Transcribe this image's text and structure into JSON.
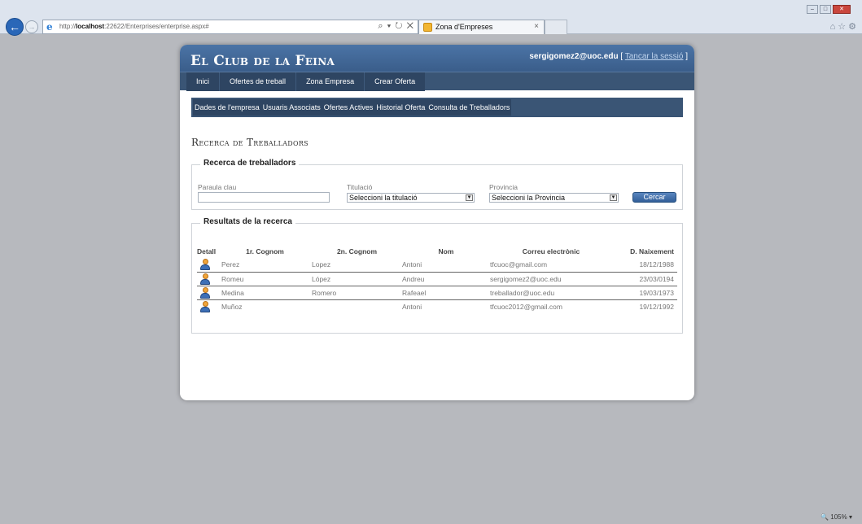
{
  "browser": {
    "url_prefix": "http://",
    "url_host": "localhost",
    "url_rest": ":22622/Enterprises/enterprise.aspx#",
    "address_tools": "⌕ ▾ ↻ ✕",
    "tab_title": "Zona d'Empreses",
    "tab_close": "×",
    "zoom": "105%"
  },
  "site": {
    "logo": "El Club de la Feina",
    "user_email": "sergigomez2@uoc.edu",
    "bracket_open": "[",
    "logout": "Tancar la sessió",
    "bracket_close": "]"
  },
  "menu": {
    "items": [
      {
        "label": "Inici"
      },
      {
        "label": "Ofertes de treball"
      },
      {
        "label": "Zona Empresa"
      },
      {
        "label": "Crear Oferta"
      }
    ]
  },
  "submenu": {
    "items": [
      {
        "label": "Dades de l'empresa"
      },
      {
        "label": "Usuaris Associats"
      },
      {
        "label": "Ofertes Actives"
      },
      {
        "label": "Historial Oferta"
      },
      {
        "label": "Consulta de Treballadors"
      }
    ]
  },
  "page": {
    "title": "Recerca de Treballadors"
  },
  "search": {
    "legend": "Recerca de treballadors",
    "keyword_label": "Paraula clau",
    "keyword_value": "",
    "degree_label": "Titulació",
    "degree_selected": "Seleccioni la titulació",
    "province_label": "Provincia",
    "province_selected": "Seleccioni la Provincia",
    "search_button": "Cercar"
  },
  "results": {
    "legend": "Resultats de la recerca",
    "columns": {
      "detail": "Detall",
      "surname1": "1r. Cognom",
      "surname2": "2n. Cognom",
      "name": "Nom",
      "email": "Correu electrònic",
      "birth": "D. Naixement"
    },
    "rows": [
      {
        "surname1": "Perez",
        "surname2": "Lopez",
        "name": "Antoni",
        "email": "tfcuoc@gmail.com",
        "birth": "18/12/1988"
      },
      {
        "surname1": "Romeu",
        "surname2": "López",
        "name": "Andreu",
        "email": "sergigomez2@uoc.edu",
        "birth": "23/03/0194"
      },
      {
        "surname1": "Medina",
        "surname2": "Romero",
        "name": "Rafeael",
        "email": "treballador@uoc.edu",
        "birth": "19/03/1973"
      },
      {
        "surname1": "Muñoz",
        "surname2": "",
        "name": "Antoni",
        "email": "tfcuoc2012@gmail.com",
        "birth": "19/12/1992"
      }
    ]
  }
}
